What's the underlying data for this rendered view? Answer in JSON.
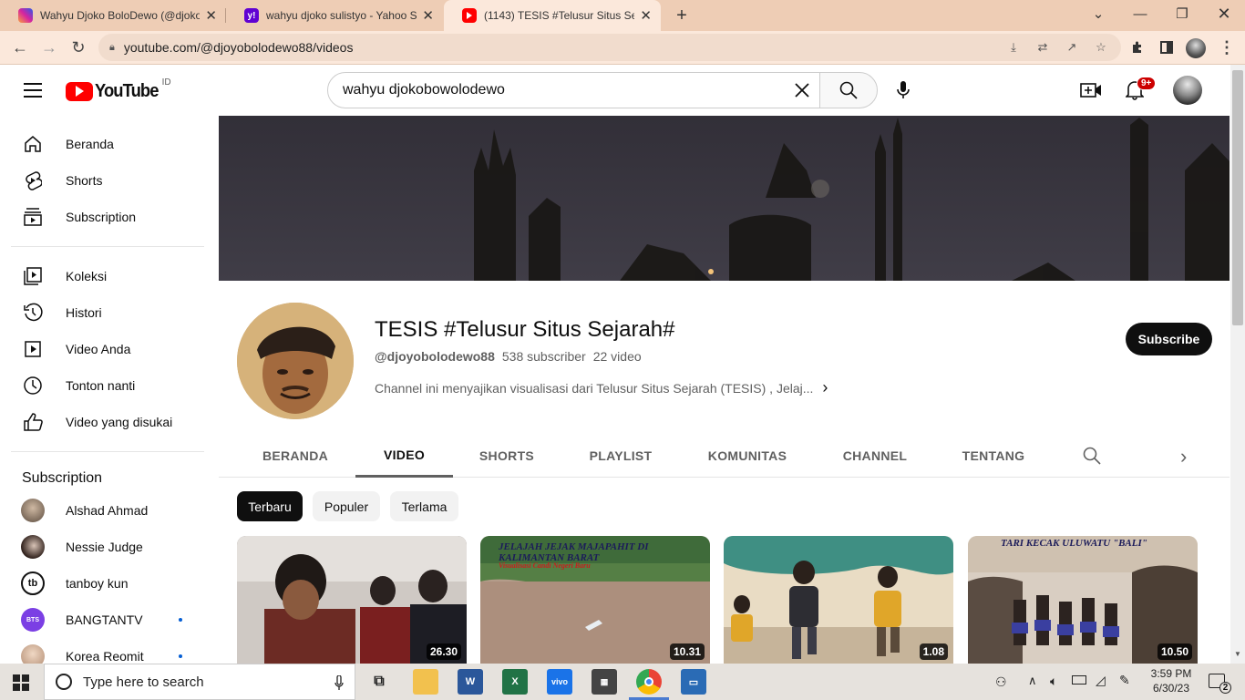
{
  "browser": {
    "tabs": [
      {
        "title": "Wahyu Djoko BoloDewo (@djoko",
        "favicon": "instagram-icon"
      },
      {
        "title": "wahyu djoko sulistyo - Yahoo Sea",
        "favicon": "yahoo-icon"
      },
      {
        "title": "(1143) TESIS #Telusur Situs Sejara",
        "favicon": "youtube-icon",
        "active": true
      }
    ],
    "new_tab": "+",
    "url": "youtube.com/@djoyobolodewo88/videos"
  },
  "yt_header": {
    "logo_text": "YouTube",
    "region": "ID",
    "search_value": "wahyu djokobowolodewo",
    "notification_badge": "9+"
  },
  "sidebar": {
    "main_items": [
      {
        "label": "Beranda",
        "icon": "home-icon"
      },
      {
        "label": "Shorts",
        "icon": "shorts-icon"
      },
      {
        "label": "Subscription",
        "icon": "subscriptions-icon"
      }
    ],
    "library_items": [
      {
        "label": "Koleksi",
        "icon": "library-icon"
      },
      {
        "label": "Histori",
        "icon": "history-icon"
      },
      {
        "label": "Video Anda",
        "icon": "your-videos-icon"
      },
      {
        "label": "Tonton nanti",
        "icon": "watch-later-icon"
      },
      {
        "label": "Video yang disukai",
        "icon": "like-icon"
      }
    ],
    "subscriptions_title": "Subscription",
    "subscriptions": [
      {
        "name": "Alshad Ahmad",
        "color": "#8a7a6a",
        "new": false
      },
      {
        "name": "Nessie Judge",
        "color": "#3b2a25",
        "new": false
      },
      {
        "name": "tanboy kun",
        "color": "#111111",
        "new": false
      },
      {
        "name": "BANGTANTV",
        "color": "#7b3fe4",
        "badge": "BTS",
        "new": true
      },
      {
        "name": "Korea Reomit",
        "color": "#d9b9a0",
        "new": true
      }
    ]
  },
  "channel": {
    "name": "TESIS #Telusur Situs Sejarah#",
    "handle": "@djoyobolodewo88",
    "subscribers": "538 subscriber",
    "video_count": "22 video",
    "description": "Channel ini menyajikan visualisasi dari Telusur Situs Sejarah (TESIS) , Jelaj...",
    "subscribe_label": "Subscribe"
  },
  "channel_tabs": [
    {
      "label": "BERANDA",
      "active": false
    },
    {
      "label": "VIDEO",
      "active": true
    },
    {
      "label": "SHORTS",
      "active": false
    },
    {
      "label": "PLAYLIST",
      "active": false
    },
    {
      "label": "KOMUNITAS",
      "active": false
    },
    {
      "label": "CHANNEL",
      "active": false
    },
    {
      "label": "TENTANG",
      "active": false
    }
  ],
  "chips": [
    {
      "label": "Terbaru",
      "active": true
    },
    {
      "label": "Populer",
      "active": false
    },
    {
      "label": "Terlama",
      "active": false
    }
  ],
  "videos": [
    {
      "duration": "26.30",
      "overlay": ""
    },
    {
      "duration": "10.31",
      "overlay": "JELAJAH JEJAK MAJAPAHIT DI KALIMANTAN BARAT",
      "overlay2": "Visualisasi Candi Negeri Baru"
    },
    {
      "duration": "1.08",
      "overlay": ""
    },
    {
      "duration": "10.50",
      "overlay": "TARI KECAK ULUWATU \"BALI\""
    }
  ],
  "taskbar": {
    "search_placeholder": "Type here to search",
    "time": "3:59 PM",
    "date": "6/30/23",
    "notifications": "2"
  }
}
